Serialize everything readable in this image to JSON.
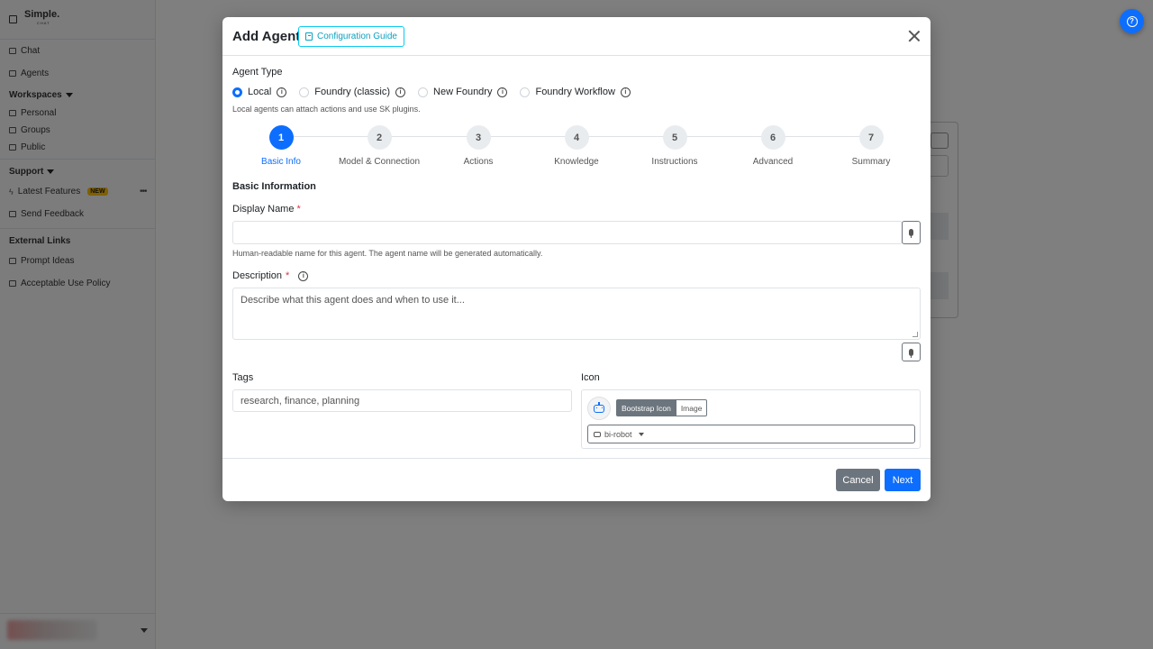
{
  "sidebar": {
    "brand": "Simple.",
    "brand_sub": "CHAT",
    "items": [
      {
        "label": "Chat"
      },
      {
        "label": "Agents"
      }
    ],
    "workspaces_label": "Workspaces",
    "workspace_items": [
      {
        "label": "Personal"
      },
      {
        "label": "Groups"
      },
      {
        "label": "Public"
      }
    ],
    "support_label": "Support",
    "support_items": [
      {
        "label": "Latest Features",
        "badge": "NEW"
      },
      {
        "label": "Send Feedback"
      }
    ],
    "external_label": "External Links",
    "external_items": [
      {
        "label": "Prompt Ideas"
      },
      {
        "label": "Acceptable Use Policy"
      }
    ]
  },
  "modal": {
    "title": "Add Agent",
    "guide_button": "Configuration Guide",
    "agent_type_label": "Agent Type",
    "agent_types": [
      {
        "label": "Local",
        "checked": true
      },
      {
        "label": "Foundry (classic)",
        "checked": false
      },
      {
        "label": "New Foundry",
        "checked": false
      },
      {
        "label": "Foundry Workflow",
        "checked": false
      }
    ],
    "agent_type_help": "Local agents can attach actions and use SK plugins.",
    "steps": [
      {
        "num": "1",
        "label": "Basic Info"
      },
      {
        "num": "2",
        "label": "Model & Connection"
      },
      {
        "num": "3",
        "label": "Actions"
      },
      {
        "num": "4",
        "label": "Knowledge"
      },
      {
        "num": "5",
        "label": "Instructions"
      },
      {
        "num": "6",
        "label": "Advanced"
      },
      {
        "num": "7",
        "label": "Summary"
      }
    ],
    "section_title": "Basic Information",
    "display_name_label": "Display Name",
    "required_mark": "*",
    "display_name_value": "",
    "display_name_help": "Human-readable name for this agent. The agent name will be generated automatically.",
    "description_label": "Description",
    "description_placeholder": "Describe what this agent does and when to use it...",
    "tags_label": "Tags",
    "tags_placeholder": "research, finance, planning",
    "icon_label": "Icon",
    "icon_mode_bootstrap": "Bootstrap Icon",
    "icon_mode_image": "Image",
    "icon_value": "bi-robot",
    "cancel": "Cancel",
    "next": "Next"
  },
  "colors": {
    "primary": "#0d6efd",
    "secondary": "#6c757d",
    "info": "#0dcaf0",
    "danger": "#dc3545",
    "warning": "#ffc107"
  }
}
